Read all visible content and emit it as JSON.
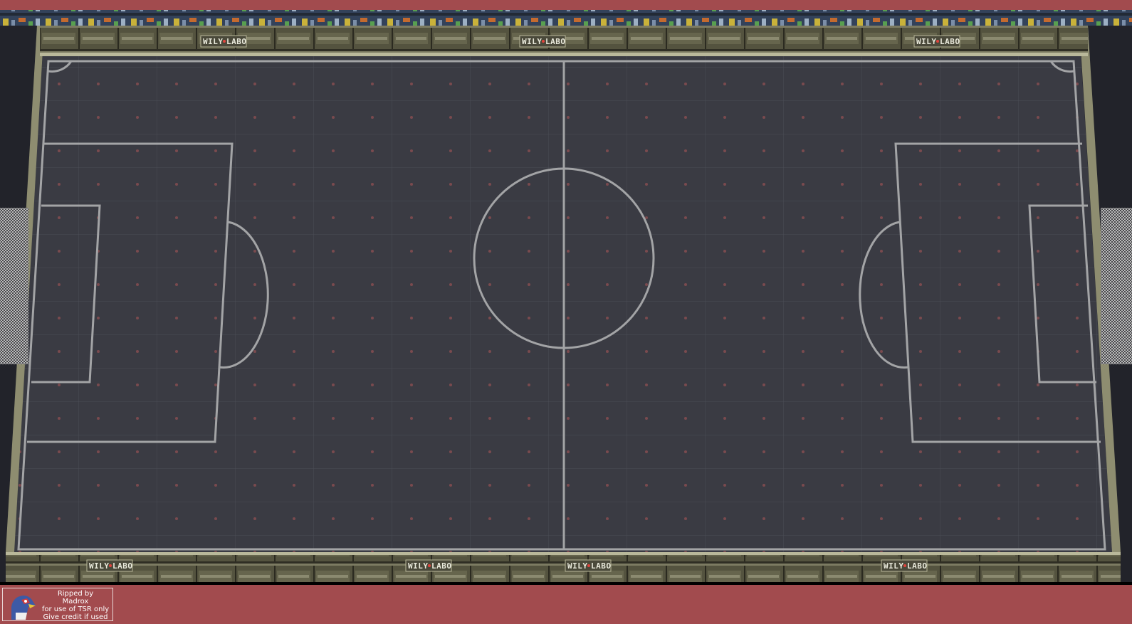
{
  "stage": {
    "name": "Wily Labo soccer field",
    "signs": {
      "top": [
        "WILY",
        "LABO",
        "WILY",
        "LABO",
        "WILY",
        "LABO"
      ],
      "bottom": [
        "WILY",
        "LABO",
        "WILY",
        "LABO",
        "WILY",
        "LABO",
        "WILY",
        "LABO"
      ]
    },
    "sign_dot_color": "#e0433c"
  },
  "credits": {
    "line1": "Ripped by",
    "line2": "Madrox",
    "line3": "for use of TSR only",
    "line4": "Give credit if used"
  },
  "colors": {
    "background": "#a24b4e",
    "field": "#3b3c44",
    "lines": "#a3a4a6",
    "wall": "#5a5a46"
  },
  "icons": {
    "mascot": "falco-mascot-icon"
  }
}
